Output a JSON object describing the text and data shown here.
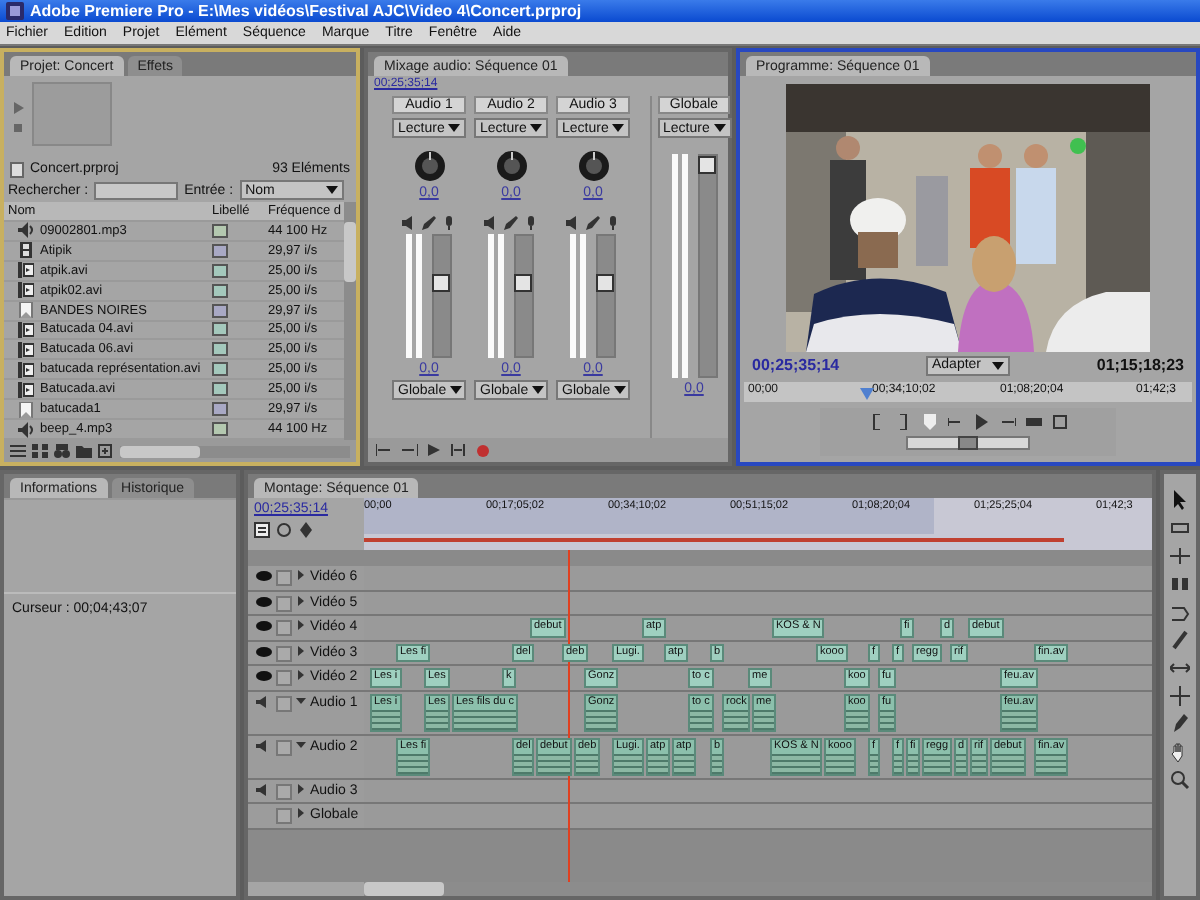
{
  "window": {
    "title": "Adobe Premiere Pro - E:\\Mes vidéos\\Festival AJC\\Video 4\\Concert.prproj"
  },
  "menu": [
    "Fichier",
    "Edition",
    "Projet",
    "Elément",
    "Séquence",
    "Marque",
    "Titre",
    "Fenêtre",
    "Aide"
  ],
  "project": {
    "tabs": [
      {
        "label": "Projet: Concert",
        "selected": true
      },
      {
        "label": "Effets",
        "selected": false
      }
    ],
    "file": "Concert.prproj",
    "count": "93 Eléments",
    "search_label": "Rechercher :",
    "entry_label": "Entrée :",
    "entry_value": "Nom",
    "columns": [
      "Nom",
      "Libellé",
      "Fréquence d"
    ],
    "rows": [
      {
        "kind": "audio",
        "name": "09002801.mp3",
        "color": "#b4c8b0",
        "rate": "44 100 Hz"
      },
      {
        "kind": "sequence",
        "name": "Atipik",
        "color": "#a8a8c4",
        "rate": "29,97 i/s"
      },
      {
        "kind": "video",
        "name": "atpik.avi",
        "color": "#a4c8bc",
        "rate": "25,00 i/s"
      },
      {
        "kind": "video",
        "name": "atpik02.avi",
        "color": "#a4c8bc",
        "rate": "25,00 i/s"
      },
      {
        "kind": "still",
        "name": "BANDES NOIRES",
        "color": "#a8a8c4",
        "rate": "29,97 i/s"
      },
      {
        "kind": "video",
        "name": "Batucada 04.avi",
        "color": "#a4c8bc",
        "rate": "25,00 i/s"
      },
      {
        "kind": "video",
        "name": "Batucada 06.avi",
        "color": "#a4c8bc",
        "rate": "25,00 i/s"
      },
      {
        "kind": "video",
        "name": "batucada représentation.avi",
        "color": "#a4c8bc",
        "rate": "25,00 i/s"
      },
      {
        "kind": "video",
        "name": "Batucada.avi",
        "color": "#a4c8bc",
        "rate": "25,00 i/s"
      },
      {
        "kind": "still",
        "name": "batucada1",
        "color": "#a8a8c4",
        "rate": "29,97 i/s"
      },
      {
        "kind": "audio",
        "name": "beep_4.mp3",
        "color": "#b4c8b0",
        "rate": "44 100 Hz"
      }
    ]
  },
  "mixer": {
    "tab": "Mixage audio: Séquence 01",
    "timecode": "00;25;35;14",
    "channels": [
      {
        "name": "Audio 1",
        "mode": "Lecture",
        "pan": "0,0",
        "level": 0.62,
        "volume": "0,0",
        "output": "Globale"
      },
      {
        "name": "Audio 2",
        "mode": "Lecture",
        "pan": "0,0",
        "level": 0.62,
        "volume": "0,0",
        "output": "Globale"
      },
      {
        "name": "Audio 3",
        "mode": "Lecture",
        "pan": "0,0",
        "level": 0.62,
        "volume": "0,0",
        "output": "Globale"
      }
    ],
    "master": {
      "name": "Globale",
      "mode": "Lecture",
      "level": 0.96,
      "volume": "0,0"
    }
  },
  "program": {
    "tab": "Programme: Séquence 01",
    "timecode": "00;25;35;14",
    "zoom": "Adapter",
    "duration": "01;15;18;23",
    "ruler": [
      "00;00",
      "00;34;10;02",
      "01;08;20;04",
      "01;42;3"
    ],
    "shuttle": {
      "level": 0.5
    }
  },
  "info": {
    "tabs": [
      {
        "label": "Informations",
        "selected": true
      },
      {
        "label": "Historique",
        "selected": false
      }
    ],
    "cursor": "Curseur : 00;04;43;07"
  },
  "timeline": {
    "tab": "Montage: Séquence 01",
    "timecode": "00;25;35;14",
    "ruler": [
      "00;00",
      "00;17;05;02",
      "00;34;10;02",
      "00;51;15;02",
      "01;08;20;04",
      "01;25;25;04",
      "01;42;3"
    ],
    "tracks": [
      {
        "kind": "video",
        "name": "Vidéo 6",
        "expanded": false
      },
      {
        "kind": "video",
        "name": "Vidéo 5",
        "expanded": false
      },
      {
        "kind": "video",
        "name": "Vidéo 4",
        "expanded": false,
        "clips": [
          "debut",
          "atp",
          "KOS & N",
          "fi",
          "d",
          "debut"
        ]
      },
      {
        "kind": "video",
        "name": "Vidéo 3",
        "expanded": false,
        "clips": [
          "Les fi",
          "del",
          "deb",
          "Lugi.",
          "atp",
          "b",
          "kooo",
          "f",
          "f",
          "regg",
          "rif",
          "fin.av"
        ]
      },
      {
        "kind": "video",
        "name": "Vidéo 2",
        "expanded": false,
        "clips": [
          "Les i",
          "Les",
          "k",
          "Gonz",
          "to c",
          "me",
          "koo",
          "fu",
          "feu.av"
        ]
      },
      {
        "kind": "audio",
        "name": "Audio 1",
        "expanded": true,
        "clips": [
          "Les i",
          "Les",
          "Les fils du c",
          "Gonz",
          "to c",
          "rock",
          "me",
          "koo",
          "fu",
          "feu.av"
        ]
      },
      {
        "kind": "audio",
        "name": "Audio 2",
        "expanded": true,
        "clips": [
          "Les fi",
          "del",
          "debut",
          "deb",
          "Lugi.",
          "atp",
          "atp",
          "b",
          "KOS & N",
          "kooo",
          "f",
          "f",
          "fi",
          "regg",
          "d",
          "rif",
          "debut",
          "fin.av"
        ]
      },
      {
        "kind": "audio",
        "name": "Audio 3",
        "expanded": false
      },
      {
        "kind": "master",
        "name": "Globale",
        "expanded": false
      }
    ]
  }
}
